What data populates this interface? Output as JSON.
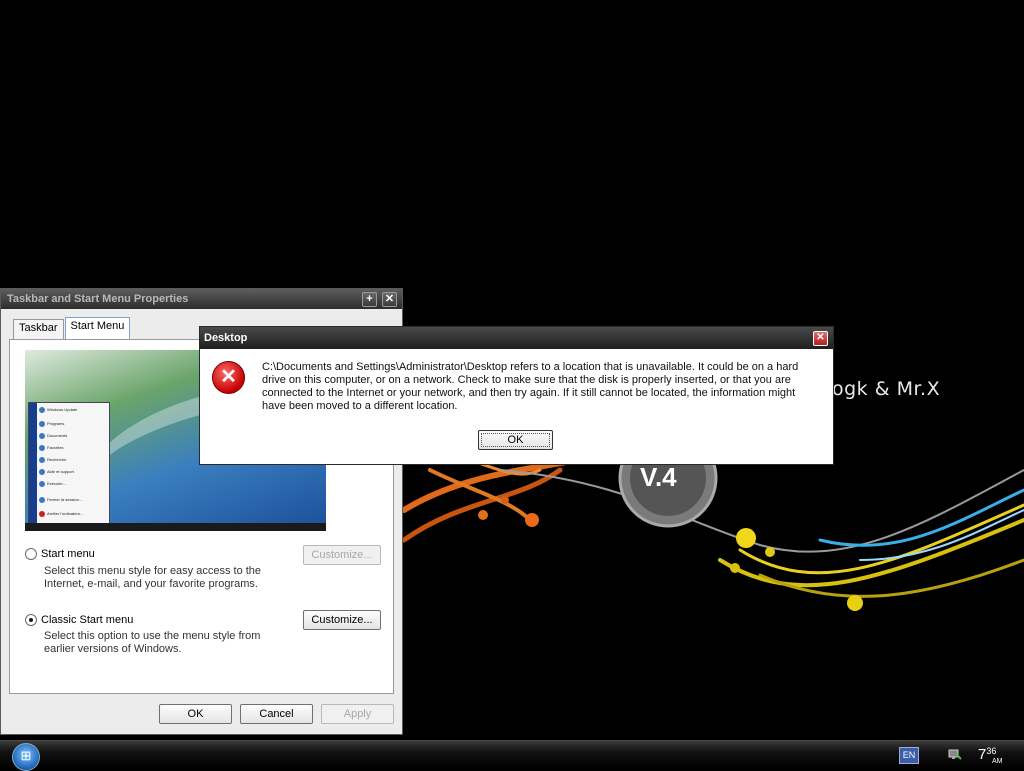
{
  "desktop": {
    "brand_text": "ogk & Mr.X",
    "badge_text": "V.4"
  },
  "props_window": {
    "title": "Taskbar and Start Menu Properties",
    "tabs": [
      {
        "label": "Taskbar",
        "active": false
      },
      {
        "label": "Start Menu",
        "active": true
      }
    ],
    "preview_menu_items": [
      "Windows Update",
      "Programs",
      "Documents",
      "Favorites",
      "Recherche",
      "Aide et support",
      "Exécuter...",
      "Fermer la session...",
      "Arrêter l'ordinateur..."
    ],
    "option_start": {
      "label": "Start menu",
      "checked": false,
      "description": "Select this menu style for easy access to the Internet, e-mail, and your favorite programs.",
      "button": "Customize...",
      "button_enabled": false
    },
    "option_classic": {
      "label": "Classic Start menu",
      "checked": true,
      "description": "Select this option to use the menu style from earlier versions of Windows.",
      "button": "Customize...",
      "button_enabled": true
    },
    "buttons": {
      "ok": "OK",
      "cancel": "Cancel",
      "apply": "Apply"
    }
  },
  "error_dialog": {
    "title": "Desktop",
    "icon": "error-x-icon",
    "message": "C:\\Documents and Settings\\Administrator\\Desktop refers to a location that is unavailable. It could be on a hard drive on this computer, or on a network. Check to make sure that the disk is properly inserted, or that you are connected to the Internet or your network, and then try again. If it still cannot be located, the information might have been moved to a different location.",
    "ok_label": "OK"
  },
  "taskbar": {
    "language": "EN",
    "clock_hour": "7",
    "clock_minutes": "36",
    "clock_ampm": "AM"
  },
  "colors": {
    "error_red": "#c40000",
    "title_bar": "#2c2c2c"
  }
}
